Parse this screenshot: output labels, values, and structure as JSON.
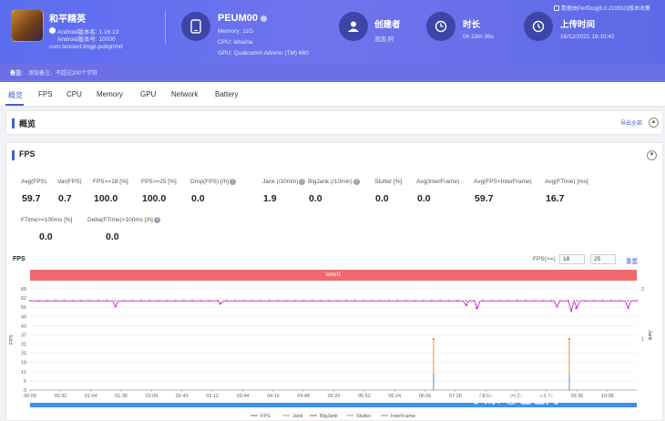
{
  "app": {
    "name": "和平精英",
    "android_version": "Android版本名: 1.16.13",
    "android_code": "Android版本号: 10000",
    "package": "com.tencent.tmgp.pubgmhd"
  },
  "device": {
    "name": "PEUM00",
    "memory": "Memory: 11G",
    "cpu": "CPU: lahaina",
    "gpu": "GPU: Qualcomm Adreno (TM) 660"
  },
  "creator": {
    "label": "创建者",
    "value": "泡泡 阿"
  },
  "duration": {
    "label": "时长",
    "value": "0h 10m 39s"
  },
  "upload": {
    "label": "上传时间",
    "value": "16/12/2021 18:10:42"
  },
  "topright": "数据由PerfDog(6.0.210910)版本收集",
  "note": {
    "label": "备注:",
    "placeholder": "添加备注，不超过200个字符"
  },
  "tabs": [
    "概览",
    "FPS",
    "CPU",
    "Memory",
    "GPU",
    "Network",
    "Battery"
  ],
  "overview": {
    "title": "概览",
    "export": "导出全部"
  },
  "fps_section": {
    "title": "FPS"
  },
  "stats_row1": [
    {
      "label": "Avg(FPS)",
      "value": "59.7",
      "help": false
    },
    {
      "label": "Var(FPS)",
      "value": "0.7",
      "help": false
    },
    {
      "label": "FPS>=18 [%]",
      "value": "100.0",
      "help": false
    },
    {
      "label": "FPS>=25 [%]",
      "value": "100.0",
      "help": false
    },
    {
      "label": "Drop(FPS) [/h]",
      "value": "0.0",
      "help": true
    },
    {
      "label": "Jank (/10min)",
      "value": "1.9",
      "help": true
    },
    {
      "label": "BigJank (/10min)",
      "value": "0.0",
      "help": true
    },
    {
      "label": "Stutter [%]",
      "value": "0.0",
      "help": false
    },
    {
      "label": "Avg(InterFrame)",
      "value": "0.0",
      "help": false
    },
    {
      "label": "Avg(FPS+InterFrame)",
      "value": "59.7",
      "help": false
    },
    {
      "label": "Avg(FTime) [ms]",
      "value": "16.7",
      "help": false
    }
  ],
  "stats_row2": [
    {
      "label": "FTime>=100ms [%]",
      "value": "0.0",
      "help": false
    },
    {
      "label": "Delta(FTime)>100ms [/h]",
      "value": "0.0",
      "help": true
    }
  ],
  "chart_header": {
    "label": "FPS",
    "filter": "FPS(>=)",
    "threshold1": "18",
    "threshold2": "25",
    "reset": "重置"
  },
  "colors": {
    "accent": "#4a5bd6",
    "fps": "#c23cc4",
    "jank": "#f08a3c",
    "bigjank": "#e04040",
    "stutter": "#9aa0b4",
    "interframe": "#5b8cf0"
  },
  "watermark": "头条 @包包网",
  "chart_data": {
    "type": "line",
    "band_label": "label1",
    "y_left_label": "FPS",
    "y_right_label": "Jank",
    "y_ticks": [
      "0",
      "6",
      "12",
      "19",
      "25",
      "31",
      "37",
      "43",
      "49",
      "56",
      "62",
      "68"
    ],
    "y_right_ticks": [
      "1",
      "2"
    ],
    "x_ticks": [
      "00:00",
      "00:32",
      "01:04",
      "01:36",
      "02:08",
      "02:40",
      "03:12",
      "03:44",
      "04:16",
      "04:48",
      "05:20",
      "05:52",
      "06:24",
      "06:56",
      "07:28",
      "08:00",
      "08:32",
      "09:04",
      "09:36",
      "10:08"
    ],
    "ylim": [
      0,
      68
    ],
    "xlim_seconds": [
      0,
      639
    ],
    "fps_baseline": 60,
    "fps_dips": [
      {
        "t": 90,
        "fps": 56
      },
      {
        "t": 200,
        "fps": 58
      },
      {
        "t": 460,
        "fps": 57
      },
      {
        "t": 470,
        "fps": 55
      },
      {
        "t": 555,
        "fps": 56
      },
      {
        "t": 570,
        "fps": 53
      },
      {
        "t": 575,
        "fps": 55
      },
      {
        "t": 630,
        "fps": 55
      }
    ],
    "jank_events": [
      {
        "t": 425,
        "value": 1
      },
      {
        "t": 568,
        "value": 1
      }
    ],
    "legend": [
      "FPS",
      "Jank",
      "BigJank",
      "Stutter",
      "InterFrame"
    ]
  }
}
